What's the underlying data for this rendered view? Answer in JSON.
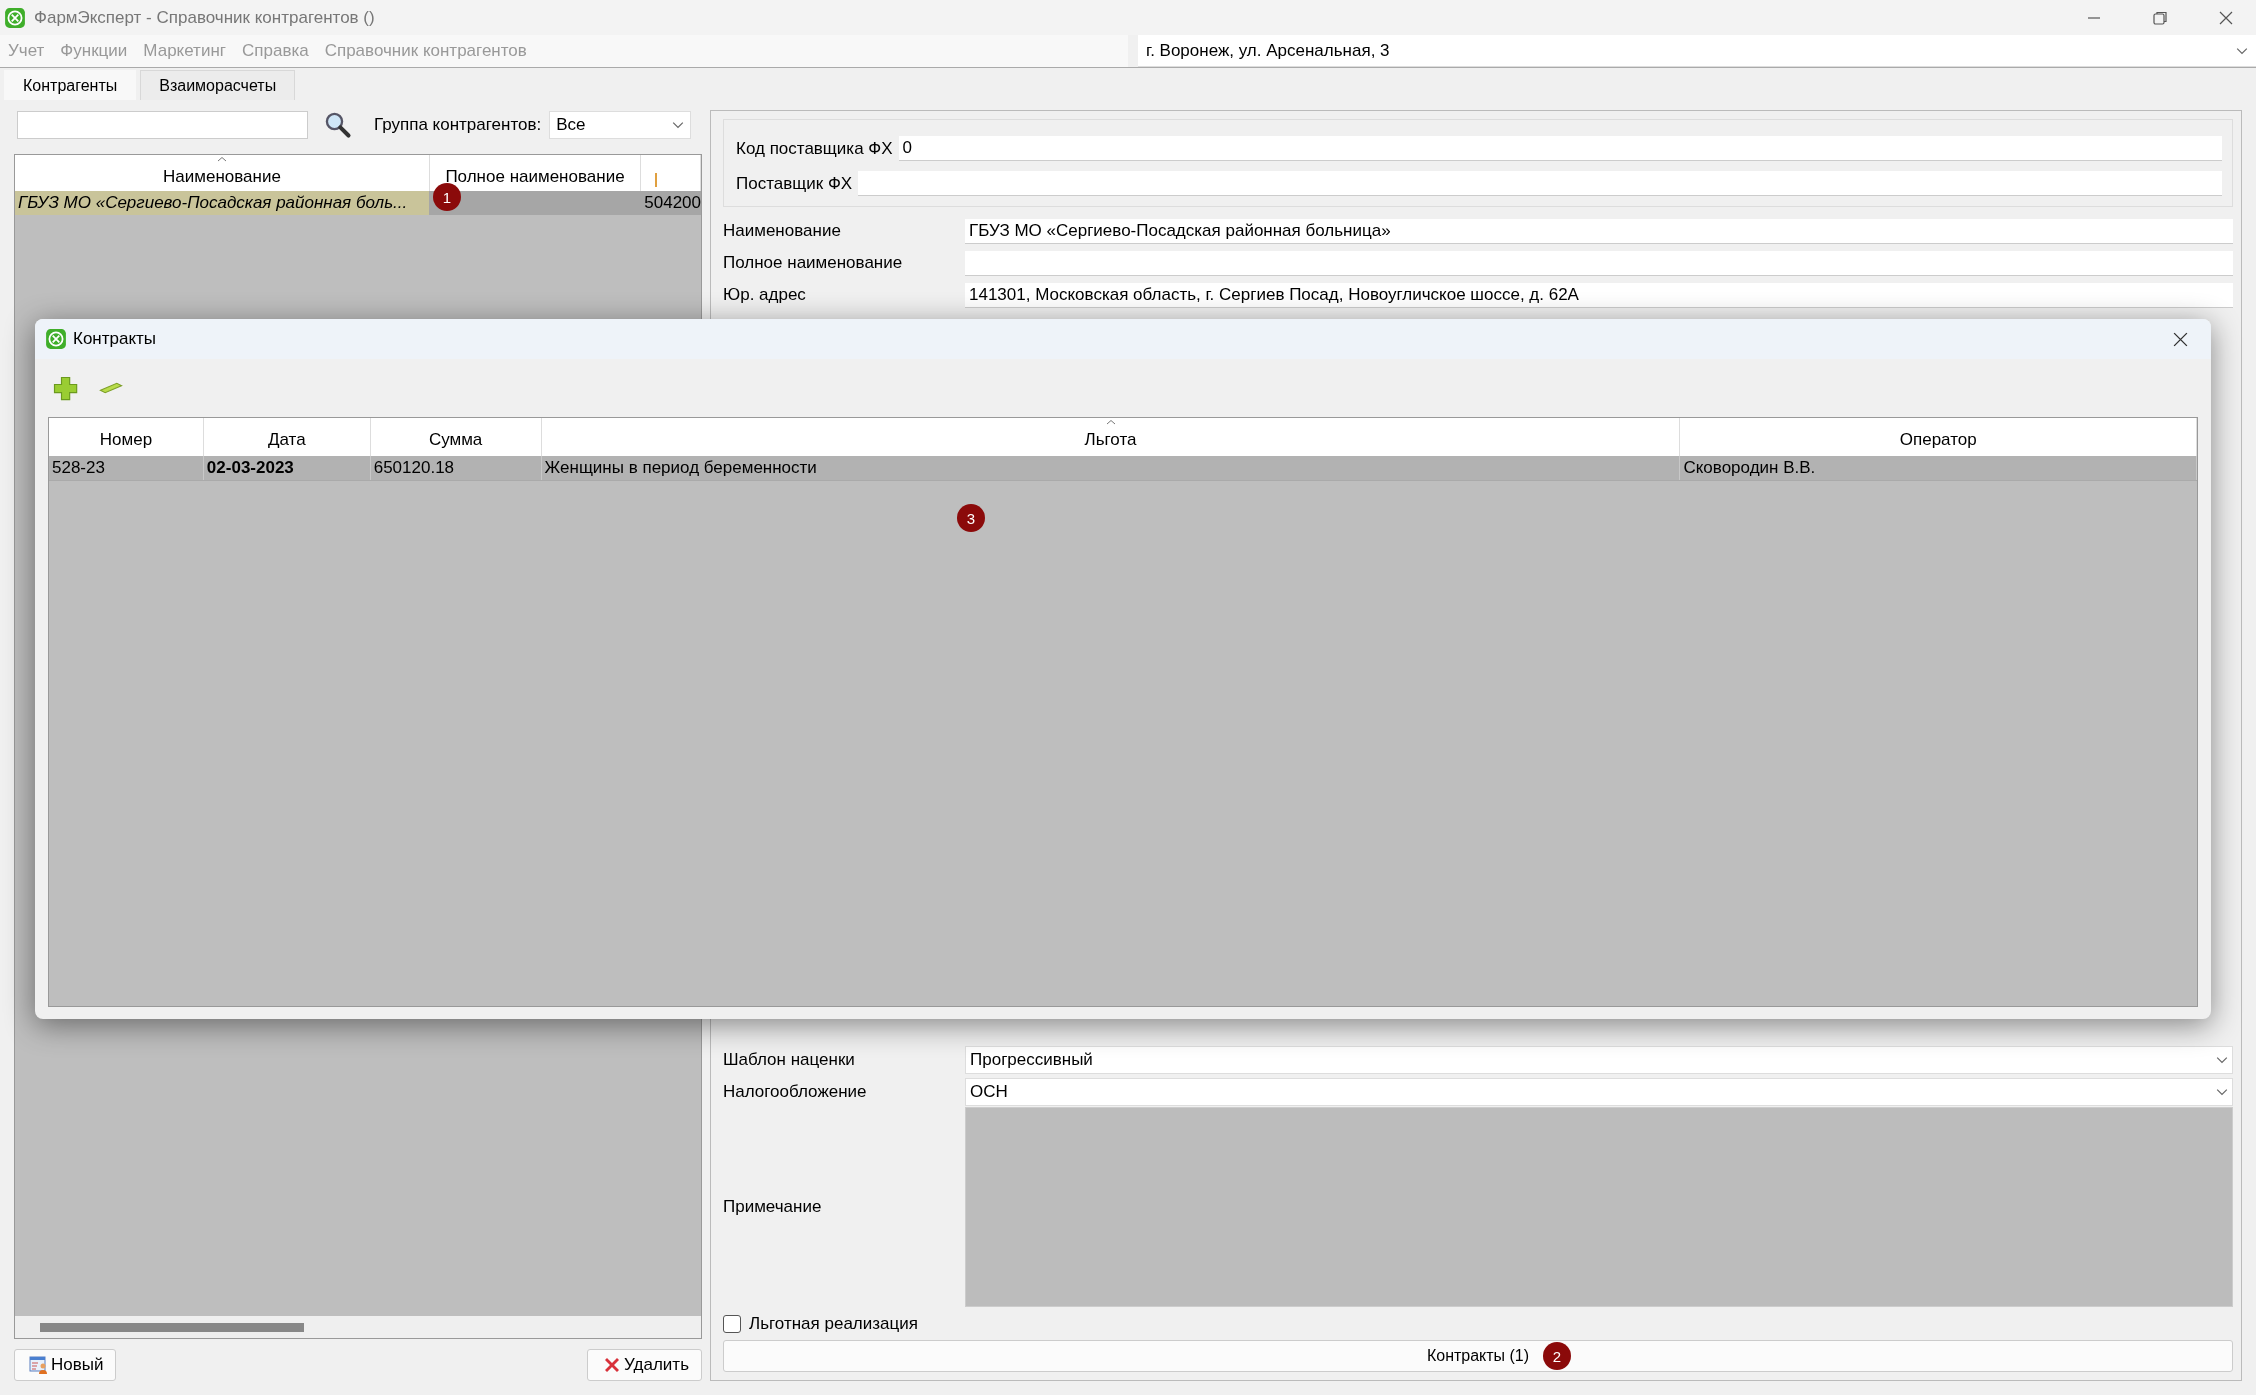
{
  "window": {
    "title": "ФармЭксперт - Справочник контрагентов ()"
  },
  "menu": [
    "Учет",
    "Функции",
    "Маркетинг",
    "Справка",
    "Справочник контрагентов"
  ],
  "address": {
    "value": "г. Воронеж, ул. Арсенальная, 3"
  },
  "tabs": [
    {
      "label": "Контрагенты",
      "selected": true
    },
    {
      "label": "Взаиморасчеты",
      "selected": false
    }
  ],
  "group_filter": {
    "label": "Группа контрагентов:",
    "value": "Все"
  },
  "contractors_table": {
    "marker": "1",
    "columns": [
      {
        "label": "Наименование",
        "sorted": true
      },
      {
        "label": "Полное наименование",
        "sorted": false
      }
    ],
    "rows": [
      {
        "name": "ГБУЗ МО «Сергиево-Посадская районная боль...",
        "column_3": "504200",
        "selected": true
      }
    ]
  },
  "buttons": {
    "new": "Новый",
    "delete": "Удалить"
  },
  "supplier_group": [
    {
      "label": "Код поставщика ФХ",
      "value": "0"
    },
    {
      "label": "Поставщик ФХ"
    }
  ],
  "fields": [
    {
      "label": "Наименование",
      "value": "ГБУЗ МО «Сергиево-Посадская районная больница»"
    },
    {
      "label": "Полное наименование"
    },
    {
      "label": "Юр. адрес",
      "value": "141301, Московская область, г. Сергиев Посад, Новоугличское шоссе, д. 62А"
    }
  ],
  "selects": [
    {
      "label": "Шаблон наценки",
      "value": "Прогрессивный"
    },
    {
      "label": "Налогообложение",
      "value": "ОСН"
    }
  ],
  "note": {
    "label": "Примечание"
  },
  "preferential": {
    "label": "Льготная реализация",
    "checked": false
  },
  "contracts_button": {
    "label": "Контракты (1)",
    "marker": "2"
  },
  "dialog": {
    "title": "Контракты",
    "marker": "3",
    "columns": [
      {
        "label": "Номер",
        "sorted": false
      },
      {
        "label": "Дата",
        "sorted": false
      },
      {
        "label": "Сумма",
        "sorted": false
      },
      {
        "label": "Льгота",
        "sorted": true
      },
      {
        "label": "Оператор",
        "sorted": false
      }
    ],
    "rows": [
      {
        "cells": [
          "528-23",
          "02-03-2023",
          "650120.18",
          "Женщины в период беременности",
          "Сковородин В.В."
        ],
        "selected": true
      }
    ]
  }
}
